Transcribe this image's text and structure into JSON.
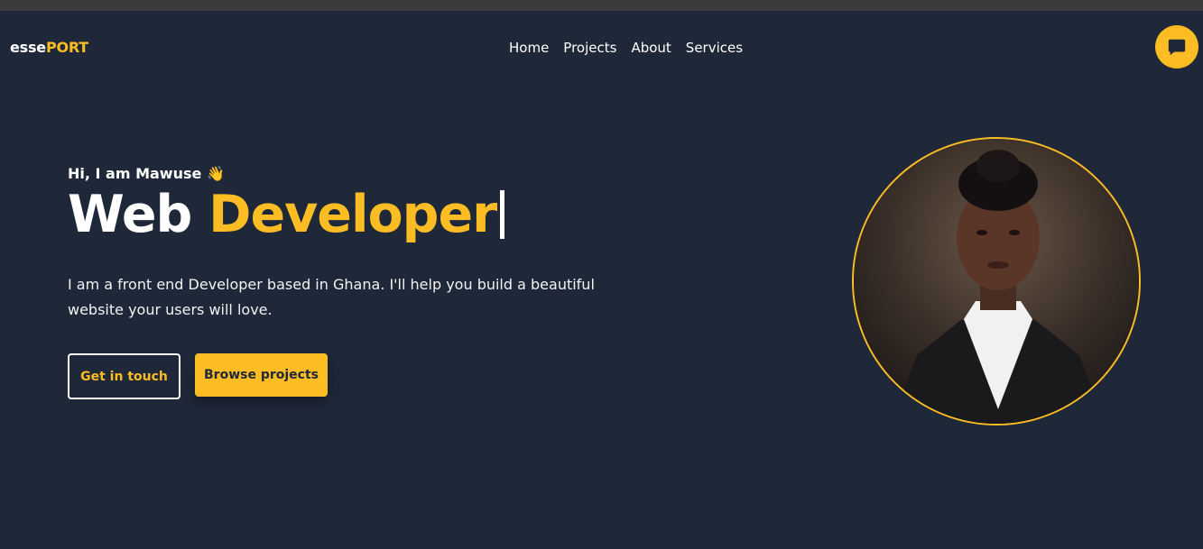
{
  "nav": {
    "logo_prefix": "esse",
    "logo_accent": "PORT",
    "items": [
      {
        "label": "Home"
      },
      {
        "label": "Projects"
      },
      {
        "label": "About"
      },
      {
        "label": "Services"
      }
    ],
    "chat_icon": "chat-bubble-icon"
  },
  "hero": {
    "greeting": "Hi, I am Mawuse",
    "greeting_emoji": "👋",
    "headline_prefix": "Web",
    "headline_role": "Developer",
    "description": "I am a front end Developer based in Ghana. I'll help you build a beautiful website your users will love.",
    "buttons": {
      "primary_outline": "Get in touch",
      "secondary_solid": "Browse projects"
    }
  },
  "colors": {
    "background": "#1f2839",
    "accent": "#fbbd23",
    "text": "#ffffff"
  }
}
